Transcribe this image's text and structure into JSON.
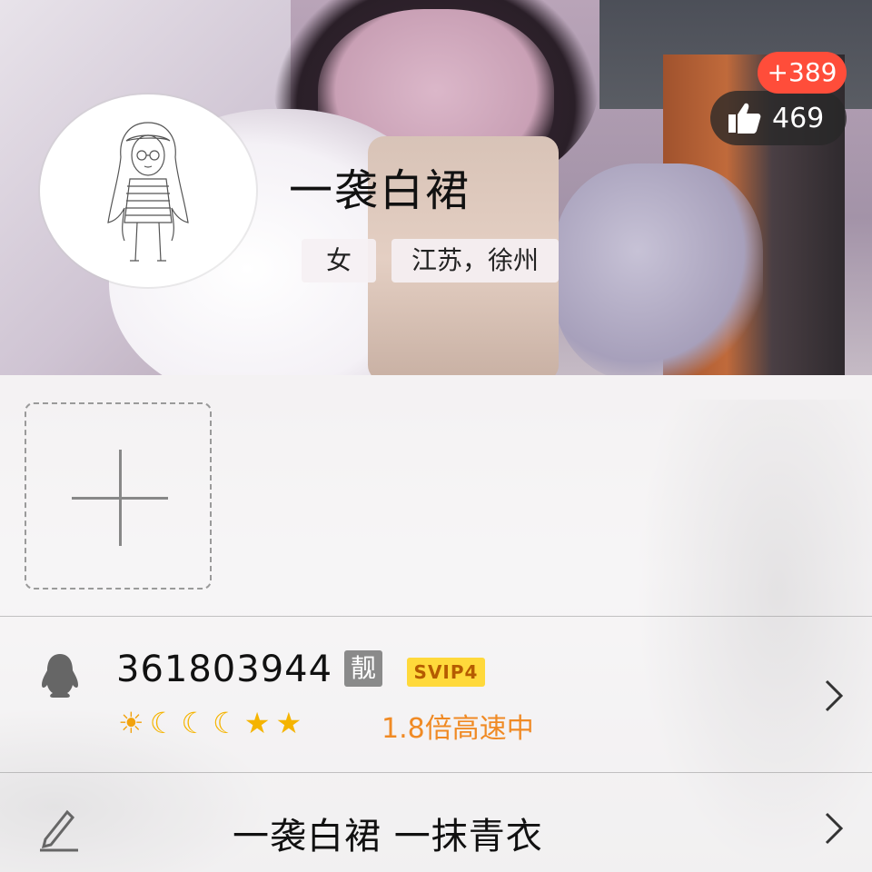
{
  "profile": {
    "nickname": "一袭白裙",
    "gender": "女",
    "location": "江苏，徐州",
    "likes": "469",
    "likes_new": "+389"
  },
  "account": {
    "qq_number": "361803944",
    "liang_label": "靓",
    "svip_label": "SVIP4",
    "level_icons": [
      "sun-icon",
      "moon-icon",
      "moon-icon",
      "moon-icon",
      "star-icon",
      "star-icon"
    ],
    "speed_text": "1.8倍高速中"
  },
  "signature": {
    "text": "一袭白裙 一抹青衣"
  },
  "colors": {
    "badge_red": "#ff4d3a",
    "svip_yellow": "#ffd93b",
    "speed_orange": "#f08a24"
  }
}
